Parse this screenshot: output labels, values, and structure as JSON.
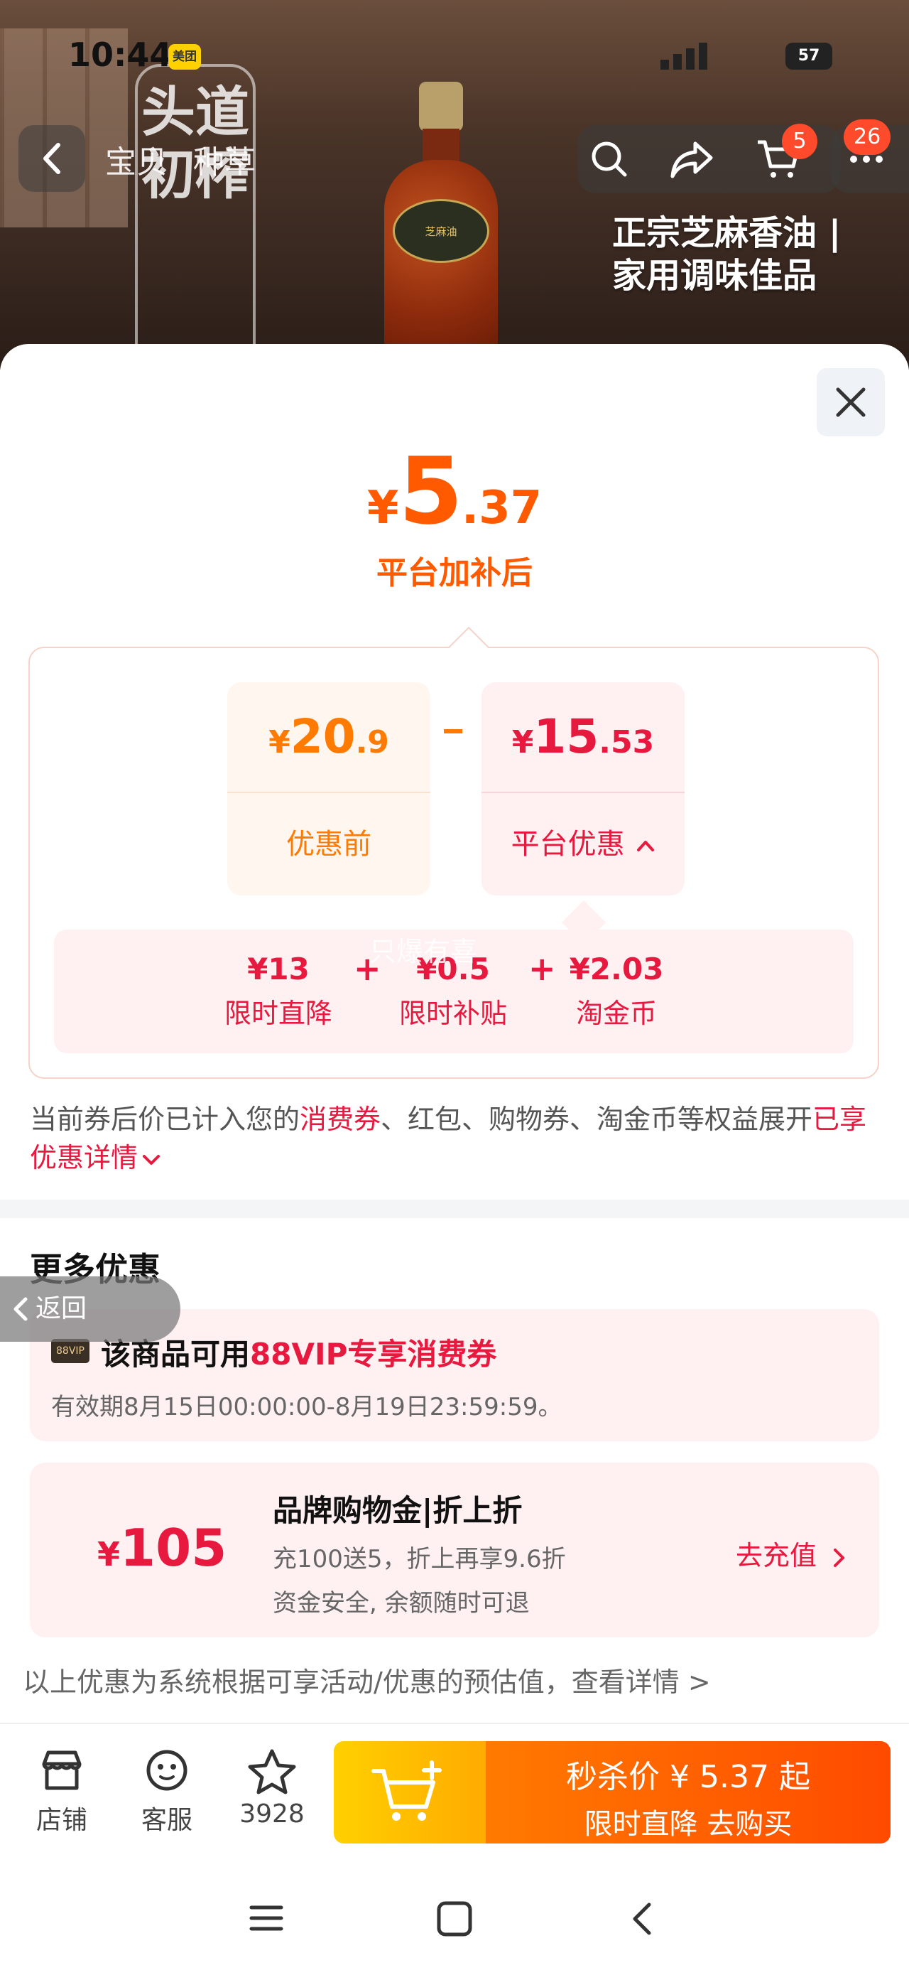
{
  "status_bar": {
    "time": "10:44",
    "app_badge": "美团",
    "battery": "57"
  },
  "hero": {
    "banner_text": "头道初榨",
    "bottle_label": "芝麻油",
    "tagline_line1": "正宗芝麻香油 |",
    "tagline_line2": "家用调味佳品"
  },
  "top_nav": {
    "tabs": [
      "宝贝",
      "种草"
    ],
    "cart_badge": "5",
    "more_badge": "26"
  },
  "price_sheet": {
    "final_currency": "¥",
    "final_int": "5",
    "final_dec": ".37",
    "final_caption": "平台加补后",
    "before": {
      "currency": "¥",
      "int": "20",
      "dec": ".9",
      "label": "优惠前"
    },
    "minus": "-",
    "platform": {
      "currency": "¥",
      "int": "15",
      "dec": ".53",
      "label": "平台优惠"
    },
    "breakdown": [
      {
        "value": "¥13",
        "label": "限时直降"
      },
      {
        "value": "¥0.5",
        "label": "限时补贴"
      },
      {
        "value": "¥2.03",
        "label": "淘金币"
      }
    ],
    "plus": "+",
    "watermark": "只爆有喜",
    "note_pre": "当前券后价已计入您的",
    "note_red1": "消费券",
    "note_mid": "、红包、购物券、淘金币等权益展开",
    "note_red2": "已享优惠详情"
  },
  "more_offers": {
    "title": "更多优惠",
    "vip": {
      "tag": "88VIP",
      "title_pre": "该商品可用",
      "title_red": "88VIP专享消费券",
      "validity": "有效期8月15日00:00:00-8月19日23:59:59。"
    },
    "brand": {
      "currency": "¥",
      "amount": "105",
      "title": "品牌购物金|折上折",
      "line1": "充100送5，折上再享9.6折",
      "line2": "资金安全, 余额随时可退",
      "cta": "去充值"
    },
    "disclaimer": "以上优惠为系统根据可享活动/优惠的预估值，查看详情 >"
  },
  "float_back": "返回",
  "bottom_bar": {
    "store": "店铺",
    "service": "客服",
    "favorites": "3928",
    "cta_line1": "秒杀价 ¥ 5.37 起",
    "cta_line2": "限时直降  去购买"
  },
  "colors": {
    "accent_orange": "#ff5a00",
    "accent_red": "#e8193f",
    "cta_yellow": "#ffd000"
  }
}
